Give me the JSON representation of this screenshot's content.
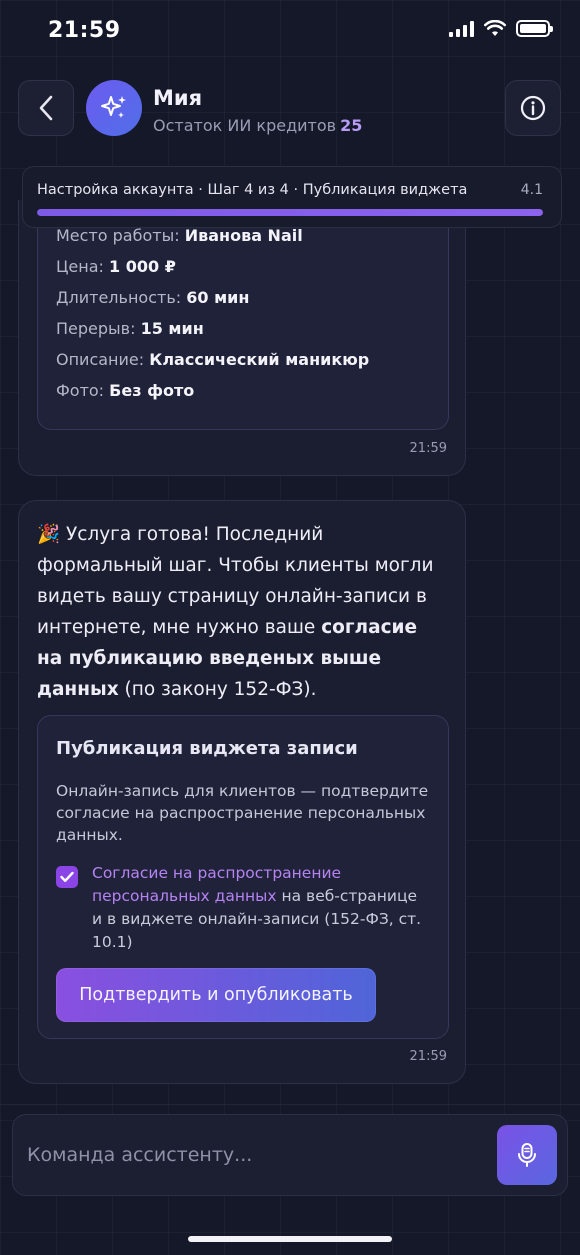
{
  "status_bar": {
    "time": "21:59"
  },
  "header": {
    "name": "Мия",
    "subtitle": "Остаток ИИ кредитов",
    "credits": "25"
  },
  "progress": {
    "text": "Настройка аккаунта · Шаг 4 из 4 · Публикация виджета",
    "version": "4.1",
    "fraction": 1.0
  },
  "service_details": {
    "rows": [
      {
        "label": "Место работы:",
        "value": "Иванова Nail"
      },
      {
        "label": "Цена:",
        "value": "1 000 ₽"
      },
      {
        "label": "Длительность:",
        "value": "60 мин"
      },
      {
        "label": "Перерыв:",
        "value": "15 мин"
      },
      {
        "label": "Описание:",
        "value": "Классический маникюр"
      },
      {
        "label": "Фото:",
        "value": "Без фото"
      }
    ],
    "time": "21:59"
  },
  "message": {
    "emoji": "🎉",
    "text_1": "Услуга готова! Последний формальный шаг. Чтобы клиенты могли видеть вашу страницу онлайн-записи в интернете, мне нужно ваше",
    "text_bold": "согласие на публикацию введеных выше данных",
    "text_2": "(по закону 152-ФЗ).",
    "time": "21:59"
  },
  "widget": {
    "title": "Публикация виджета записи",
    "description": "Онлайн-запись для клиентов — подтвердите согласие на распространение персональных данных.",
    "consent_link": "Согласие на распространение персональных данных",
    "consent_rest": "на веб-странице и в виджете онлайн-записи (152-ФЗ, ст. 10.1)",
    "checked": true,
    "button_label": "Подтвердить и опубликовать"
  },
  "input": {
    "placeholder": "Команда ассистенту..."
  },
  "colors": {
    "background": "#151829",
    "accent": "#8b45e6",
    "credits": "#b79cf5",
    "link": "#b583f2"
  }
}
